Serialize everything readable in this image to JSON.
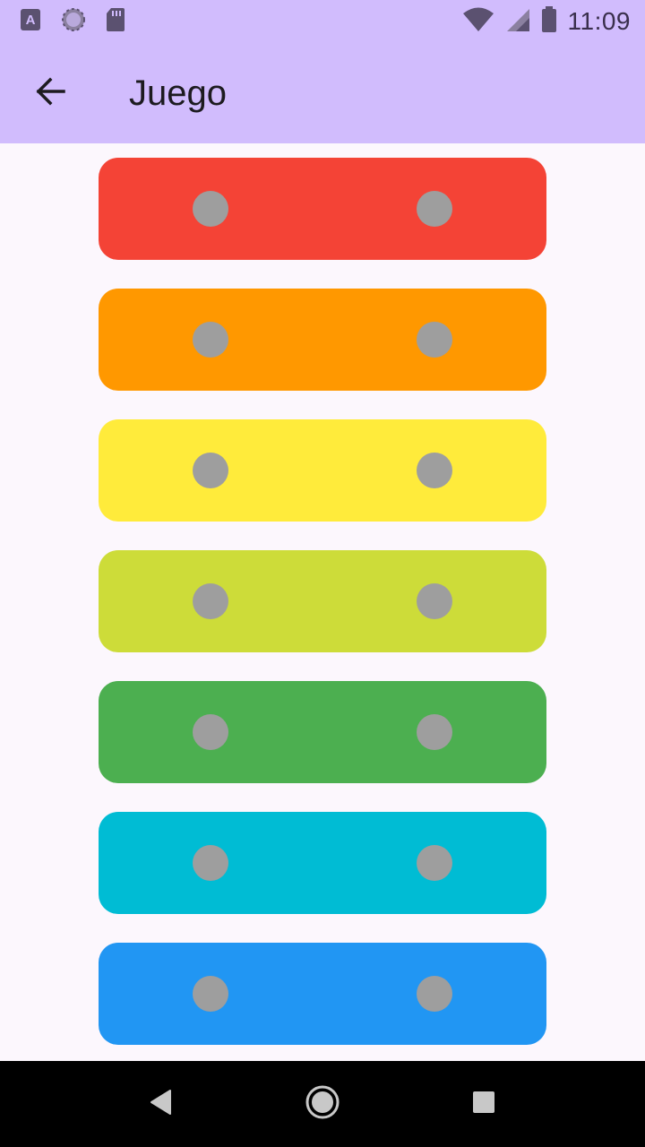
{
  "status_bar": {
    "time": "11:09",
    "icons_left": [
      "font-app-icon",
      "loading-icon",
      "sd-card-icon"
    ],
    "icons_right": [
      "wifi-icon",
      "signal-icon",
      "battery-icon"
    ]
  },
  "app_bar": {
    "title": "Juego",
    "back_icon": "arrow-back-icon"
  },
  "bars": [
    {
      "color": "#f44336"
    },
    {
      "color": "#ff9800"
    },
    {
      "color": "#ffeb3b"
    },
    {
      "color": "#cddc39"
    },
    {
      "color": "#4caf50"
    },
    {
      "color": "#00bcd4"
    },
    {
      "color": "#2196f3"
    }
  ],
  "colors": {
    "app_bar": "#d1bcfd",
    "background": "#fcf7fd",
    "dot": "#9e9e9e"
  },
  "nav_bar": {
    "buttons": [
      "back-triangle-icon",
      "home-circle-icon",
      "recents-square-icon"
    ]
  }
}
